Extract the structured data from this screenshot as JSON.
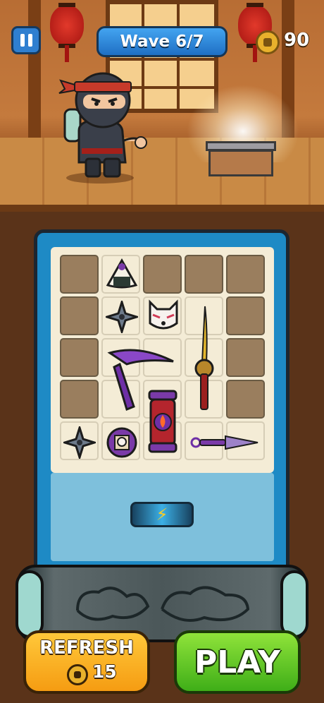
{
  "hud": {
    "wave_label": "Wave 6/7",
    "coins": "90"
  },
  "grid": {
    "rows": 5,
    "cols": 5,
    "cells": [
      [
        "locked",
        "open",
        "locked",
        "locked",
        "locked"
      ],
      [
        "locked",
        "open",
        "open",
        "open",
        "locked"
      ],
      [
        "locked",
        "open",
        "open",
        "open",
        "locked"
      ],
      [
        "locked",
        "open",
        "open",
        "open",
        "locked"
      ],
      [
        "open",
        "open",
        "open",
        "open",
        "open"
      ]
    ]
  },
  "items": [
    {
      "name": "onigiri-icon"
    },
    {
      "name": "shuriken-icon"
    },
    {
      "name": "fox-mask-icon"
    },
    {
      "name": "katana-icon"
    },
    {
      "name": "kama-sickle-icon"
    },
    {
      "name": "fire-lantern-icon"
    },
    {
      "name": "shuriken-icon"
    },
    {
      "name": "skull-pouch-icon"
    },
    {
      "name": "kunai-icon"
    }
  ],
  "energy": {
    "icon": "lightning-icon",
    "glyph": "⚡"
  },
  "buttons": {
    "refresh_label": "REFRESH",
    "refresh_cost": "15",
    "play_label": "PLAY"
  },
  "colors": {
    "wave_badge": "#2f7fd0",
    "refresh_button": "#f7a91e",
    "play_button": "#5ec724",
    "panel": "#1e8ac5"
  }
}
